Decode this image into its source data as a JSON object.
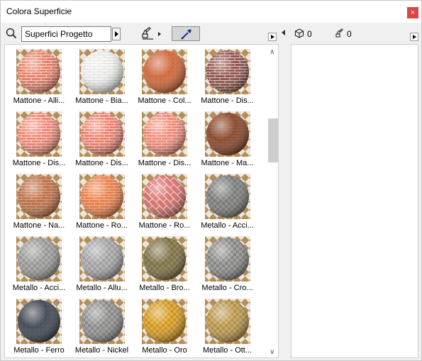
{
  "window": {
    "title": "Colora Superficie",
    "close_glyph": "×"
  },
  "toolbar": {
    "search_icon": "search-icon",
    "search_value": "Superfici Progetto",
    "surface_count": "0",
    "brush_count": "0"
  },
  "surfaces": [
    {
      "label": "Mattone - Alli...",
      "kind": "brick",
      "base": "#e8735e",
      "mortar": "#f6d8cc",
      "dark": "#b8473a"
    },
    {
      "label": "Mattone - Bia...",
      "kind": "brick",
      "base": "#f4f4f2",
      "mortar": "#d8d8d6",
      "dark": "#bdbdbb"
    },
    {
      "label": "Mattone - Col...",
      "kind": "plain",
      "base": "#d0673a",
      "mortar": "#b44e24",
      "dark": "#8a3616"
    },
    {
      "label": "Mattone - Dis...",
      "kind": "brick",
      "base": "#8a4840",
      "mortar": "#d9c6c2",
      "dark": "#4d2220"
    },
    {
      "label": "Mattone - Dis...",
      "kind": "brick",
      "base": "#ee7d6a",
      "mortar": "#fbd6ca",
      "dark": "#c2523f"
    },
    {
      "label": "Mattone - Dis...",
      "kind": "brick",
      "base": "#ee7462",
      "mortar": "#fbd6ca",
      "dark": "#c24a3a"
    },
    {
      "label": "Mattone - Dis...",
      "kind": "brick",
      "base": "#f07f6c",
      "mortar": "#f9d2c6",
      "dark": "#c6533f"
    },
    {
      "label": "Mattone - Ma...",
      "kind": "brick",
      "base": "#8e4a2c",
      "mortar": "#7a3d22",
      "dark": "#4c2210"
    },
    {
      "label": "Mattone - Na...",
      "kind": "brick",
      "base": "#b8663c",
      "mortar": "#d6a07c",
      "dark": "#7a3a1a"
    },
    {
      "label": "Mattone - Ro...",
      "kind": "brick",
      "base": "#e8763c",
      "mortar": "#f4b38c",
      "dark": "#b84c1a"
    },
    {
      "label": "Mattone - Ro...",
      "kind": "herring",
      "base": "#d66a66",
      "mortar": "#f4cfcb",
      "dark": "#a84440"
    },
    {
      "label": "Metallo - Acci...",
      "kind": "metal",
      "base": "#8a8a88",
      "mortar": "#cfcfcd",
      "dark": "#3e3e3c"
    },
    {
      "label": "Metallo - Acci...",
      "kind": "metal",
      "base": "#a8a8a6",
      "mortar": "#ececea",
      "dark": "#5e5e5c"
    },
    {
      "label": "Metallo - Allu...",
      "kind": "metal",
      "base": "#b2b2b2",
      "mortar": "#f0f0f0",
      "dark": "#6a6a6a"
    },
    {
      "label": "Metallo - Bro...",
      "kind": "metal",
      "base": "#8a7c4e",
      "mortar": "#d8cc94",
      "dark": "#463c1c"
    },
    {
      "label": "Metallo - Cro...",
      "kind": "metal",
      "base": "#9c9c9a",
      "mortar": "#f4f4f2",
      "dark": "#3a3a3a"
    },
    {
      "label": "Metallo - Ferro",
      "kind": "plain",
      "base": "#3e4650",
      "mortar": "#555c66",
      "dark": "#1e242c"
    },
    {
      "label": "Metallo - Nickel",
      "kind": "metal",
      "base": "#9e9e9c",
      "mortar": "#e6e6e4",
      "dark": "#484846"
    },
    {
      "label": "Metallo - Oro",
      "kind": "metal",
      "base": "#e4a828",
      "mortar": "#fce48a",
      "dark": "#8c5a08"
    },
    {
      "label": "Metallo - Ott...",
      "kind": "metal",
      "base": "#c8a458",
      "mortar": "#f2dca0",
      "dark": "#74561c"
    }
  ],
  "colors": {
    "close": "#e04343",
    "checker_dark": "#b38e59",
    "checker_light": "#ece6dc"
  }
}
